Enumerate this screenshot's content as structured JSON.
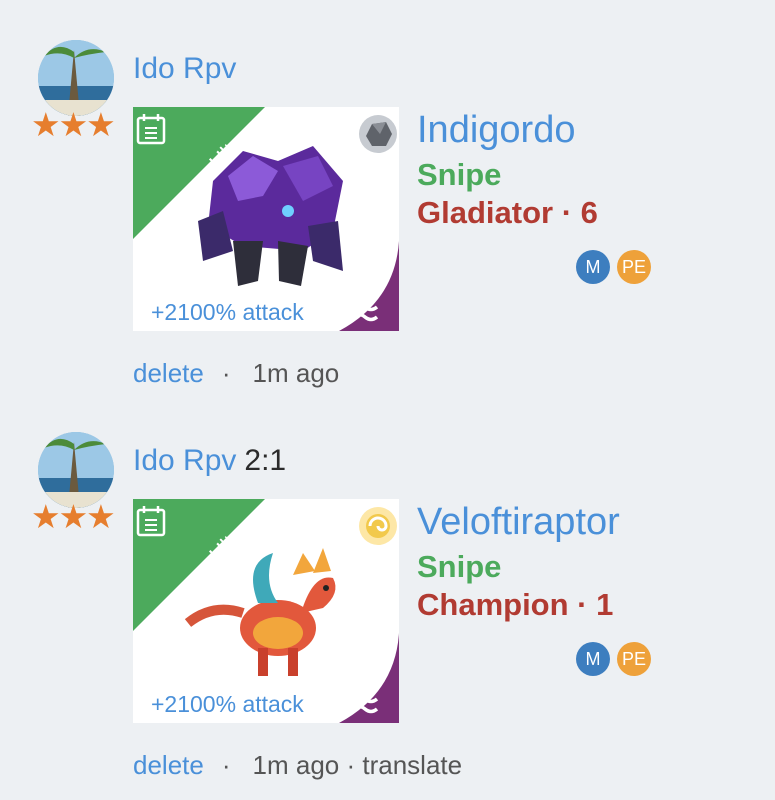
{
  "posts": [
    {
      "username": "Ido Rpv",
      "score": "",
      "stars": "★★★",
      "ribbon": "Ultra",
      "bonus": "+2100% attack",
      "creature_name": "Indigordo",
      "creature_type": "Snipe",
      "creature_rank": "Gladiator · 6",
      "badges": [
        "M",
        "PE"
      ],
      "actions": {
        "delete": "delete",
        "separator": "·",
        "time": "1m ago",
        "extra": ""
      },
      "element_icon": "rock-element-icon",
      "colors": {
        "element": "#8a8e95"
      }
    },
    {
      "username": "Ido Rpv",
      "score": "2:1",
      "stars": "★★★",
      "ribbon": "Ultra",
      "bonus": "+2100% attack",
      "creature_name": "Veloftiraptor",
      "creature_type": "Snipe",
      "creature_rank": "Champion · 1",
      "badges": [
        "M",
        "PE"
      ],
      "actions": {
        "delete": "delete",
        "separator": "·",
        "time": "1m ago",
        "extra": "· translate"
      },
      "element_icon": "wind-element-icon",
      "colors": {
        "element": "#f2c94c"
      }
    }
  ],
  "colors": {
    "link": "#4a90d9",
    "type": "#4caa5c",
    "rank": "#b13b32",
    "ribbon": "#4caa5c",
    "stars": "#e67e2e",
    "badge_m": "#3d7ebf",
    "badge_pe": "#eea13a",
    "wave_corner": "#7a2f78"
  }
}
